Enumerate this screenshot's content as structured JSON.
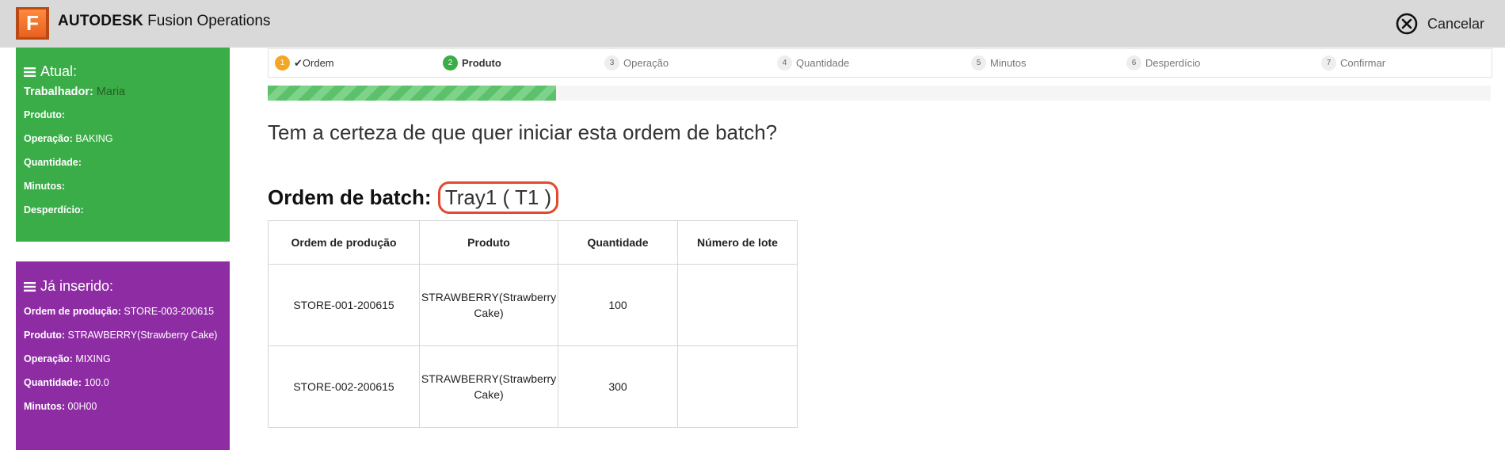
{
  "header": {
    "logo_letter": "F",
    "brand_bold": "AUTODESK",
    "brand_rest": " Fusion Operations",
    "cancel_label": "Cancelar"
  },
  "current_panel": {
    "title": "Atual:",
    "worker_label": "Trabalhador:",
    "worker_value": " Maria",
    "product_label": "Produto:",
    "product_value": "",
    "operation_label": "Operação:",
    "operation_value": " BAKING",
    "quantity_label": "Quantidade:",
    "quantity_value": "",
    "minutes_label": "Minutos:",
    "minutes_value": "",
    "waste_label": "Desperdício:",
    "waste_value": ""
  },
  "entered_panel": {
    "title": "Já inserido:",
    "order_label": "Ordem de produção:",
    "order_value": " STORE-003-200615",
    "product_label": "Produto:",
    "product_value": " STRAWBERRY(Strawberry Cake)",
    "operation_label": "Operação:",
    "operation_value": " MIXING",
    "quantity_label": "Quantidade:",
    "quantity_value": " 100.0",
    "minutes_label": "Minutos:",
    "minutes_value": " 00H00"
  },
  "steps": [
    {
      "num": "1",
      "label": "Ordem",
      "check": "✔"
    },
    {
      "num": "2",
      "label": "Produto"
    },
    {
      "num": "3",
      "label": "Operação"
    },
    {
      "num": "4",
      "label": "Quantidade"
    },
    {
      "num": "5",
      "label": "Minutos"
    },
    {
      "num": "6",
      "label": "Desperdício"
    },
    {
      "num": "7",
      "label": "Confirmar"
    }
  ],
  "progress": {
    "fraction": 0.236
  },
  "main": {
    "question": "Tem a certeza de que quer iniciar esta ordem de batch?",
    "batch_label": "Ordem de batch:",
    "batch_value": "Tray1 ( T1 )"
  },
  "table": {
    "headers": [
      "Ordem de produção",
      "Produto",
      "Quantidade",
      "Número de lote"
    ],
    "rows": [
      {
        "order": "STORE-001-200615",
        "product": "STRAWBERRY(Strawberry Cake)",
        "qty": "100",
        "lot": ""
      },
      {
        "order": "STORE-002-200615",
        "product": "STRAWBERRY(Strawberry Cake)",
        "qty": "300",
        "lot": ""
      }
    ]
  },
  "colors": {
    "accent_orange": "#f5a623",
    "success_green": "#3aad48",
    "entered_purple": "#8e2da3",
    "highlight_red": "#e04a2f"
  },
  "icons": {
    "cancel": "circle-x-icon",
    "menu": "hamburger-icon",
    "check": "check-icon"
  }
}
